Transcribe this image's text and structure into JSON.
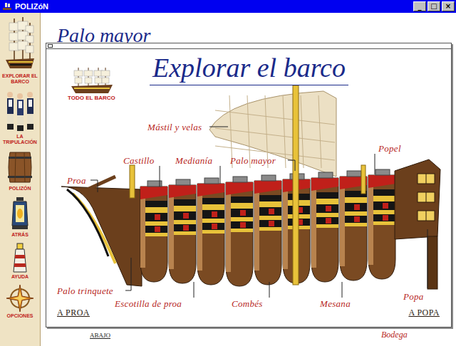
{
  "window": {
    "title": "POLIZóN",
    "controls": [
      "_",
      "□",
      "×"
    ]
  },
  "sidebar": {
    "items": [
      {
        "label": "EXPLORAR EL BARCO"
      },
      {
        "label": "LA TRIPULACIÓN"
      },
      {
        "label": "POLIZÓN"
      },
      {
        "label": "ATRÁS"
      },
      {
        "label": "AYUDA"
      },
      {
        "label": "OPCIONES"
      }
    ]
  },
  "page": {
    "title": "Palo mayor",
    "labels": [
      "ABAJO",
      "Bodega"
    ]
  },
  "dialog": {
    "title": "Explorar el barco",
    "overview": "TODO EL BARCO",
    "parts": [
      "Mástil y velas",
      "Castillo",
      "Medianía",
      "Palo mayor",
      "Popel",
      "Proa",
      "Palo trinquete",
      "Escotilla de proa",
      "Combés",
      "Mesana",
      "Popa"
    ],
    "nav": [
      "A PROA",
      "A POPA"
    ]
  }
}
